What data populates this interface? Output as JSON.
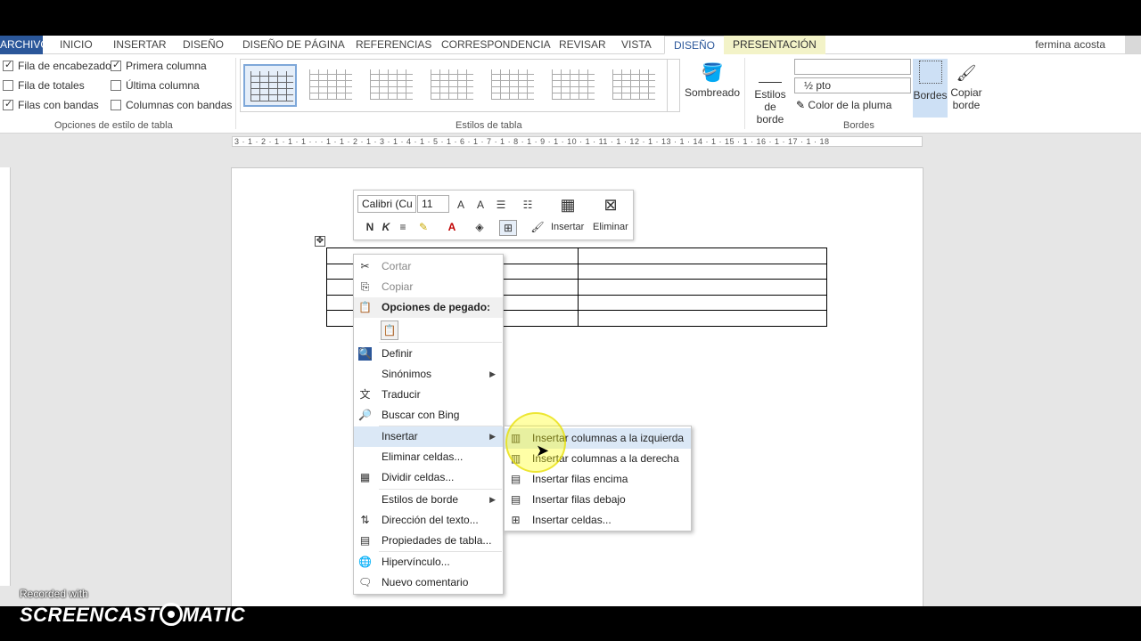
{
  "tabs": [
    {
      "label": "ARCHIVO"
    },
    {
      "label": "INICIO"
    },
    {
      "label": "INSERTAR"
    },
    {
      "label": "DISEÑO"
    },
    {
      "label": "DISEÑO DE PÁGINA"
    },
    {
      "label": "REFERENCIAS"
    },
    {
      "label": "CORRESPONDENCIA"
    },
    {
      "label": "REVISAR"
    },
    {
      "label": "VISTA"
    },
    {
      "label": "DISEÑO"
    },
    {
      "label": "PRESENTACIÓN"
    }
  ],
  "user": "fermina acosta",
  "style_options": {
    "items": [
      {
        "label": "Fila de encabezado",
        "checked": true
      },
      {
        "label": "Fila de totales",
        "checked": false
      },
      {
        "label": "Filas con bandas",
        "checked": true
      },
      {
        "label": "Primera columna",
        "checked": true
      },
      {
        "label": "Última columna",
        "checked": false
      },
      {
        "label": "Columnas con bandas",
        "checked": false
      }
    ],
    "group_label": "Opciones de estilo de tabla"
  },
  "table_styles": {
    "group_label": "Estilos de tabla"
  },
  "borders": {
    "sombreado": "Sombreado",
    "estilos_borde_1": "Estilos de",
    "estilos_borde_2": "borde",
    "width": "½ pto",
    "pen_color": "Color de la pluma",
    "bordes": "Bordes",
    "copiar_1": "Copiar",
    "copiar_2": "borde",
    "group_label": "Bordes"
  },
  "ruler_text": "3 · 1 · 2 · 1 · 1 · 1 · · · 1 · 1 · 2 · 1 · 3 · 1 · 4 · 1 · 5 · 1 · 6 · 1 · 7 · 1 · 8 · 1 · 9 · 1 · 10 · 1 · 11 · 1 · 12 · 1 · 13 · 1 · 14 · 1 · 15 · 1 · 16 · 1 · 17 · 1 · 18",
  "mini_toolbar": {
    "font": "Calibri (Cu",
    "size": "11",
    "insert_label": "Insertar",
    "delete_label": "Eliminar"
  },
  "context_menu": {
    "cut": "Cortar",
    "copy": "Copiar",
    "paste_options": "Opciones de pegado:",
    "define": "Definir",
    "synonyms": "Sinónimos",
    "translate": "Traducir",
    "bing": "Buscar con Bing",
    "insert": "Insertar",
    "delete_cells": "Eliminar celdas...",
    "split_cells": "Dividir celdas...",
    "border_styles": "Estilos de borde",
    "text_direction": "Dirección del texto...",
    "table_props": "Propiedades de tabla...",
    "hyperlink": "Hipervínculo...",
    "new_comment": "Nuevo comentario"
  },
  "submenu": {
    "items": [
      {
        "label": "Insertar columnas a la izquierda"
      },
      {
        "label": "Insertar columnas a la derecha"
      },
      {
        "label": "Insertar filas encima"
      },
      {
        "label": "Insertar filas debajo"
      },
      {
        "label": "Insertar celdas..."
      }
    ]
  },
  "watermark": {
    "small": "Recorded with",
    "big_left": "SCREENCAST",
    "big_right": "MATIC"
  }
}
